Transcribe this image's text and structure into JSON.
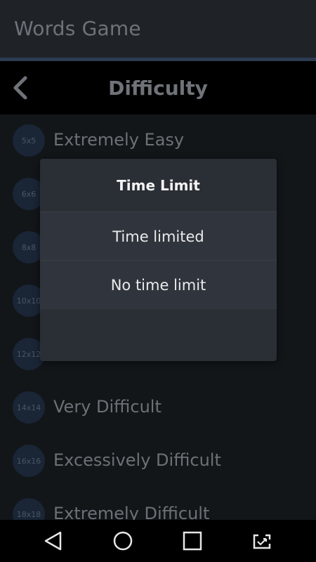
{
  "app": {
    "title": "Words Game"
  },
  "header": {
    "title": "Difficulty"
  },
  "levels": [
    {
      "size": "5x5",
      "label": "Extremely Easy"
    },
    {
      "size": "6x6",
      "label": ""
    },
    {
      "size": "8x8",
      "label": ""
    },
    {
      "size": "10x10",
      "label": ""
    },
    {
      "size": "12x12",
      "label": ""
    },
    {
      "size": "14x14",
      "label": "Very Difficult"
    },
    {
      "size": "16x16",
      "label": "Excessively Difficult"
    },
    {
      "size": "18x18",
      "label": "Extremely Difficult"
    }
  ],
  "dialog": {
    "title": "Time Limit",
    "options": [
      "Time limited",
      "No time limit"
    ]
  },
  "colors": {
    "accent_line": "#2c3a52",
    "dialog_bg": "#2a2e35",
    "badge_bg": "#1a2536"
  },
  "icons": {
    "back": "chevron-left-icon",
    "nav_back": "triangle-back-icon",
    "nav_home": "circle-home-icon",
    "nav_recents": "square-recents-icon",
    "nav_rotate": "screen-rotate-icon"
  }
}
